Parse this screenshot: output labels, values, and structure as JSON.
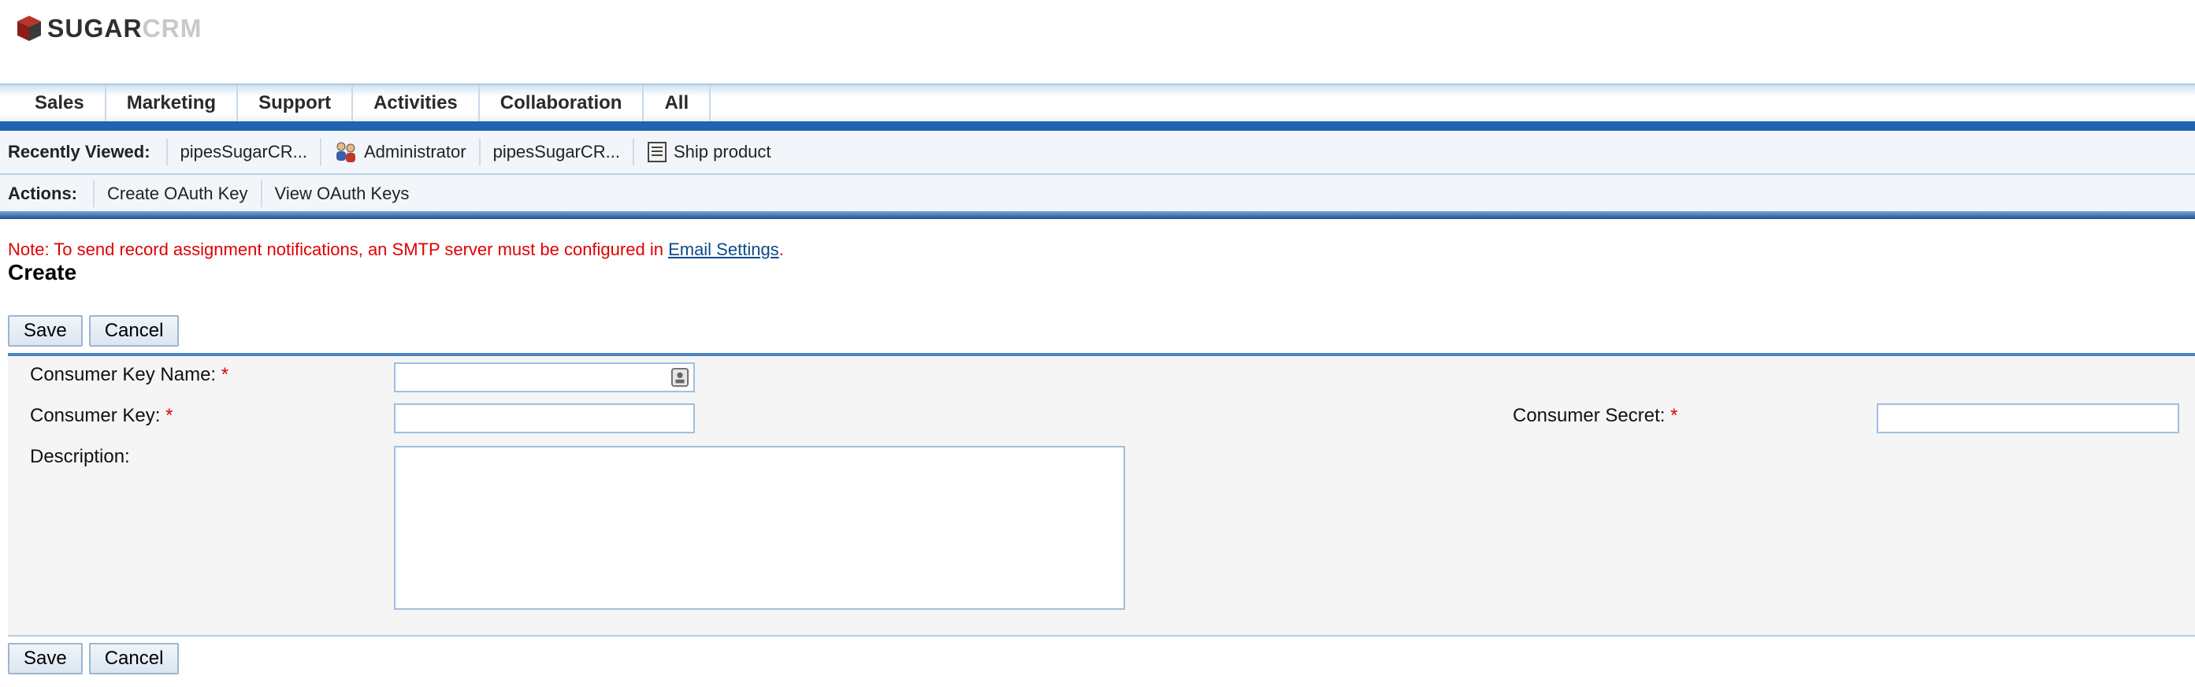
{
  "brand": {
    "sugar": "SUGAR",
    "crm": "CRM"
  },
  "tabs": [
    {
      "label": "Sales"
    },
    {
      "label": "Marketing"
    },
    {
      "label": "Support"
    },
    {
      "label": "Activities"
    },
    {
      "label": "Collaboration"
    },
    {
      "label": "All"
    }
  ],
  "recently_viewed": {
    "label": "Recently Viewed:",
    "items": [
      {
        "label": "pipesSugarCR...",
        "icon": "none"
      },
      {
        "label": "Administrator",
        "icon": "users-icon"
      },
      {
        "label": "pipesSugarCR...",
        "icon": "none"
      },
      {
        "label": "Ship product",
        "icon": "document-icon"
      }
    ]
  },
  "actions": {
    "label": "Actions:",
    "items": [
      {
        "label": "Create OAuth Key"
      },
      {
        "label": "View OAuth Keys"
      }
    ]
  },
  "note": {
    "text": "Note: To send record assignment notifications, an SMTP server must be configured in ",
    "link": "Email Settings",
    "suffix": "."
  },
  "page_title": "Create",
  "buttons": {
    "save": "Save",
    "cancel": "Cancel"
  },
  "form": {
    "consumer_key_name": {
      "label": "Consumer Key Name:",
      "required": "*",
      "value": ""
    },
    "consumer_key": {
      "label": "Consumer Key:",
      "required": "*",
      "value": ""
    },
    "consumer_secret": {
      "label": "Consumer Secret:",
      "required": "*",
      "value": ""
    },
    "description": {
      "label": "Description:",
      "value": ""
    }
  },
  "colors": {
    "accent": "#1e64b0",
    "required": "#e00000",
    "link": "#0b4b8a"
  }
}
